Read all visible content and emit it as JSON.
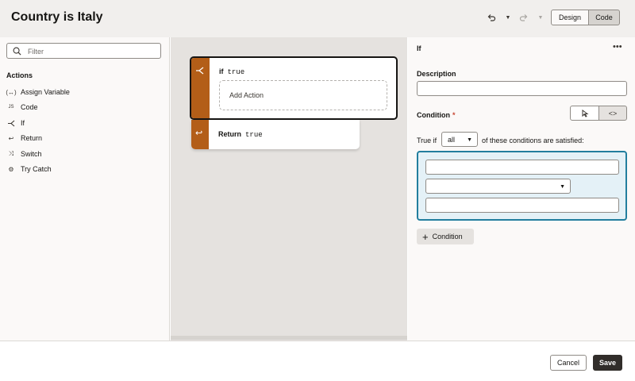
{
  "header": {
    "title": "Country is Italy",
    "undo_icon": "undo-icon",
    "redo_icon": "redo-icon",
    "design_label": "Design",
    "code_label": "Code"
  },
  "left_panel": {
    "filter_placeholder": "Filter",
    "actions_heading": "Actions",
    "actions": [
      {
        "label": "Assign Variable",
        "icon": "assign-variable-icon"
      },
      {
        "label": "Code",
        "icon": "js-code-icon"
      },
      {
        "label": "If",
        "icon": "if-branch-icon"
      },
      {
        "label": "Return",
        "icon": "return-icon"
      },
      {
        "label": "Switch",
        "icon": "switch-icon"
      },
      {
        "label": "Try Catch",
        "icon": "try-catch-icon"
      }
    ]
  },
  "canvas": {
    "if_keyword": "if",
    "if_expression": "true",
    "add_action_label": "Add Action",
    "return_keyword": "Return",
    "return_expression": "true"
  },
  "properties": {
    "title": "If",
    "description_label": "Description",
    "description_value": "",
    "condition_label": "Condition",
    "required_marker": "*",
    "true_if_label": "True if",
    "match_value": "all",
    "satisfied_label": "of these conditions are satisfied:",
    "add_condition_label": "Condition"
  },
  "footer": {
    "cancel_label": "Cancel",
    "save_label": "Save"
  },
  "colors": {
    "accent": "#b35e18",
    "condition_border": "#227e9e",
    "condition_bg": "#e4f1f7",
    "primary_button": "#312d2a"
  }
}
